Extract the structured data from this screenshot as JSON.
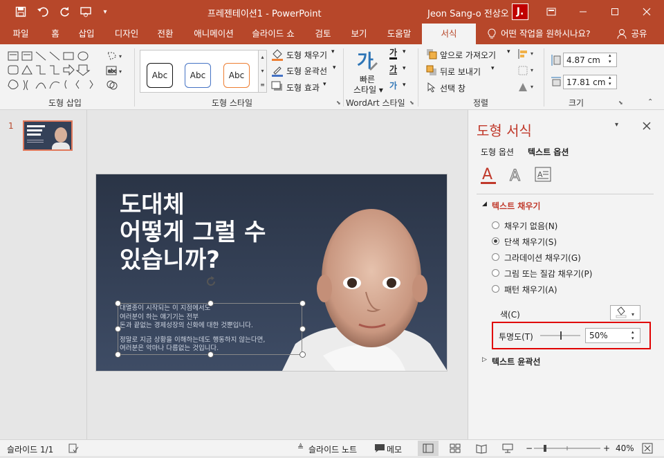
{
  "titlebar": {
    "title": "프레젠테이션1 - PowerPoint",
    "user": "Jeon Sang-o 전상오",
    "avatar": "J.",
    "qa_icons": [
      "save-icon",
      "undo-icon",
      "redo-icon",
      "present-icon",
      "customize-icon"
    ],
    "window_icons": [
      "ribbon-display-icon",
      "minimize-icon",
      "maximize-icon",
      "close-icon"
    ]
  },
  "tabs": [
    "파일",
    "홈",
    "삽입",
    "디자인",
    "전환",
    "애니메이션",
    "슬라이드 쇼",
    "검토",
    "보기",
    "도움말",
    "서식"
  ],
  "active_tab": "서식",
  "tell_me": "어떤 작업을 원하시나요?",
  "share": "공유",
  "ribbon": {
    "insert_shapes_label": "도형 삽입",
    "style_label": "도형 스타일",
    "style_abc": [
      "Abc",
      "Abc",
      "Abc"
    ],
    "shape_fill": "도형 채우기",
    "shape_outline": "도형 윤곽선",
    "shape_effects": "도형 효과",
    "wordart_label": "WordArt 스타일",
    "quick_styles": "빠른 스타일",
    "wordart_glyph": "가",
    "arrange_label": "정렬",
    "bring_forward": "앞으로 가져오기",
    "send_backward": "뒤로 보내기",
    "selection_pane": "선택 창",
    "size_label": "크기",
    "height": "4.87 cm",
    "width": "17.81 cm"
  },
  "thumb": {
    "number": "1"
  },
  "slide": {
    "title_lines": [
      "도대체",
      "어떻게 그럴 수",
      "있습니까?"
    ],
    "body_lines": [
      "대멸종이 시작되는 이 지점에서도",
      "여러분이 하는 얘기기는 전부",
      "돈과 끝없는 경제성장의 신화에 대한 것뿐입니다.",
      "",
      "정말로 지금 상황을 이해하는데도 행동하지 않는다면,",
      "여러분은 악마나 다름없는 것입니다."
    ]
  },
  "pane": {
    "title": "도형 서식",
    "tab_shape": "도형 옵션",
    "tab_text": "텍스트 옵션",
    "section_fill": "텍스트 채우기",
    "options": [
      "채우기 없음(N)",
      "단색 채우기(S)",
      "그라데이션 채우기(G)",
      "그림 또는 질감 채우기(P)",
      "패턴 채우기(A)"
    ],
    "selected_option": 1,
    "color_label": "색(C)",
    "transparency_label": "투명도(T)",
    "transparency_value": "50%",
    "section_outline": "텍스트 윤곽선",
    "accent": "#c0392b",
    "highlight": "#e00000"
  },
  "status": {
    "slide_counter": "슬라이드 1/1",
    "notes": "슬라이드 노트",
    "comments": "메모",
    "zoom": "40%"
  },
  "colors": {
    "brand": "#b7472a",
    "slide_bg": "#2e3a50"
  }
}
